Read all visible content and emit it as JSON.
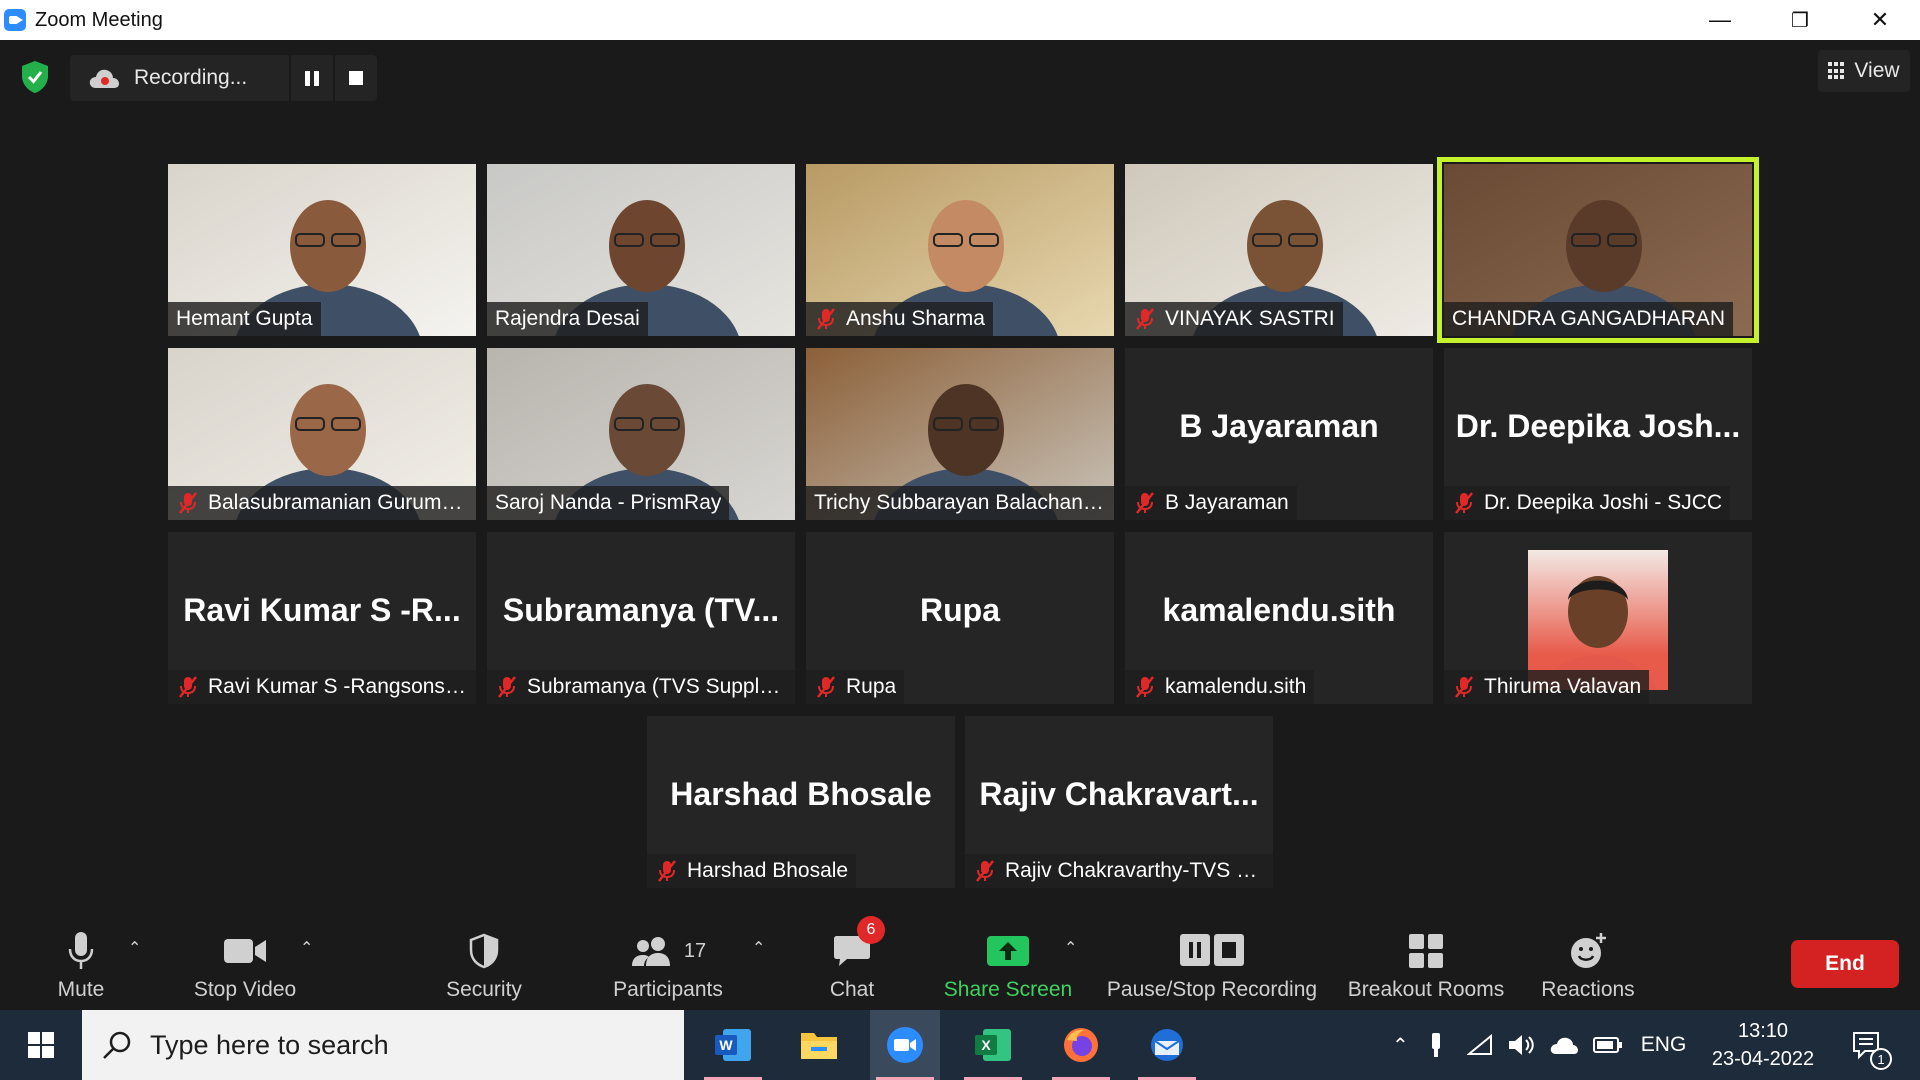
{
  "window": {
    "title": "Zoom Meeting",
    "controls": [
      "—",
      "❐",
      "✕"
    ]
  },
  "topbar": {
    "recording_label": "Recording...",
    "view_label": "View"
  },
  "participants": [
    {
      "name": "Hemant Gupta",
      "video": true,
      "muted": false,
      "active": false,
      "big": ""
    },
    {
      "name": "Rajendra Desai",
      "video": true,
      "muted": false,
      "active": false,
      "big": ""
    },
    {
      "name": "Anshu Sharma",
      "video": true,
      "muted": true,
      "active": false,
      "big": ""
    },
    {
      "name": "VINAYAK SASTRI",
      "video": true,
      "muted": true,
      "active": false,
      "big": ""
    },
    {
      "name": "CHANDRA GANGADHARAN",
      "video": true,
      "muted": false,
      "active": true,
      "big": ""
    },
    {
      "name": "Balasubramanian Gurumo...",
      "video": true,
      "muted": true,
      "active": false,
      "big": ""
    },
    {
      "name": "Saroj Nanda - PrismRay",
      "video": true,
      "muted": false,
      "active": false,
      "big": ""
    },
    {
      "name": "Trichy Subbarayan Balachandr...",
      "video": true,
      "muted": false,
      "active": false,
      "big": ""
    },
    {
      "name": "B Jayaraman",
      "video": false,
      "muted": true,
      "active": false,
      "big": "B Jayaraman"
    },
    {
      "name": "Dr. Deepika Joshi - SJCC",
      "video": false,
      "muted": true,
      "active": false,
      "big": "Dr.  Deepika  Josh..."
    },
    {
      "name": "Ravi Kumar S -Rangsons A...",
      "video": false,
      "muted": true,
      "active": false,
      "big": "Ravi  Kumar  S  -R..."
    },
    {
      "name": "Subramanya (TVS Supply C...",
      "video": false,
      "muted": true,
      "active": false,
      "big": "Subramanya  (TV..."
    },
    {
      "name": "Rupa",
      "video": false,
      "muted": true,
      "active": false,
      "big": "Rupa"
    },
    {
      "name": "kamalendu.sith",
      "video": false,
      "muted": true,
      "active": false,
      "big": "kamalendu.sith"
    },
    {
      "name": "Thiruma Valavan",
      "video": false,
      "muted": true,
      "active": false,
      "big": "",
      "photo": true
    },
    {
      "name": "Harshad Bhosale",
      "video": false,
      "muted": true,
      "active": false,
      "big": "Harshad  Bhosale"
    },
    {
      "name": "Rajiv Chakravarthy-TVS M...",
      "video": false,
      "muted": true,
      "active": false,
      "big": "Rajiv  Chakravart..."
    }
  ],
  "toolbar": {
    "mute": "Mute",
    "stop_video": "Stop Video",
    "security": "Security",
    "participants": "Participants",
    "participants_count": "17",
    "chat": "Chat",
    "chat_badge": "6",
    "share_screen": "Share Screen",
    "pause_stop_recording": "Pause/Stop Recording",
    "breakout_rooms": "Breakout Rooms",
    "reactions": "Reactions",
    "end": "End"
  },
  "taskbar": {
    "search_placeholder": "Type here to search",
    "language": "ENG",
    "time": "13:10",
    "date": "23-04-2022",
    "notification_count": "1"
  },
  "colors": {
    "active_speaker": "#c4f22c",
    "share_green": "#22c55e",
    "end_red": "#d42121",
    "muted_red": "#e02828"
  }
}
